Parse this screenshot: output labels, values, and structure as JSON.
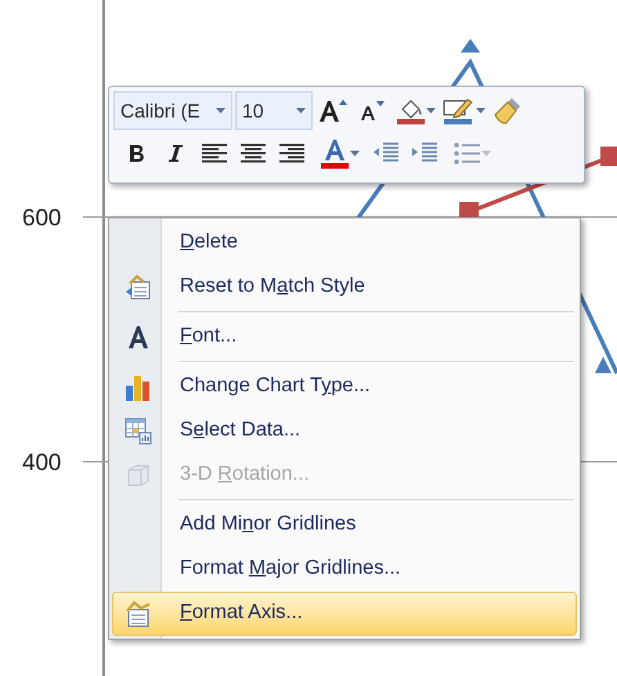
{
  "chart": {
    "y_labels": [
      "600",
      "400"
    ]
  },
  "toolbar": {
    "font_name": "Calibri (E",
    "font_size": "10"
  },
  "menu": {
    "items": [
      {
        "kind": "item",
        "key": "D",
        "after": "elete",
        "disabled": false,
        "selected": false
      },
      {
        "kind": "item",
        "before": "Reset to M",
        "key": "a",
        "after": "tch Style",
        "disabled": false,
        "selected": false
      },
      {
        "kind": "separator"
      },
      {
        "kind": "item",
        "key": "F",
        "after": "ont...",
        "disabled": false,
        "selected": false
      },
      {
        "kind": "separator"
      },
      {
        "kind": "item",
        "before": "Change Chart T",
        "key": "y",
        "after": "pe...",
        "disabled": false,
        "selected": false
      },
      {
        "kind": "item",
        "before": "S",
        "key": "e",
        "after": "lect Data...",
        "disabled": false,
        "selected": false
      },
      {
        "kind": "item",
        "before": "3-D ",
        "key": "R",
        "after": "otation...",
        "disabled": true,
        "selected": false
      },
      {
        "kind": "separator"
      },
      {
        "kind": "item",
        "before": "Add Mi",
        "key": "n",
        "after": "or Gridlines",
        "disabled": false,
        "selected": false
      },
      {
        "kind": "item",
        "before": "Format ",
        "key": "M",
        "after": "ajor Gridlines...",
        "disabled": false,
        "selected": false
      },
      {
        "kind": "item",
        "key": "F",
        "after": "ormat Axis...",
        "disabled": false,
        "selected": true
      }
    ]
  }
}
